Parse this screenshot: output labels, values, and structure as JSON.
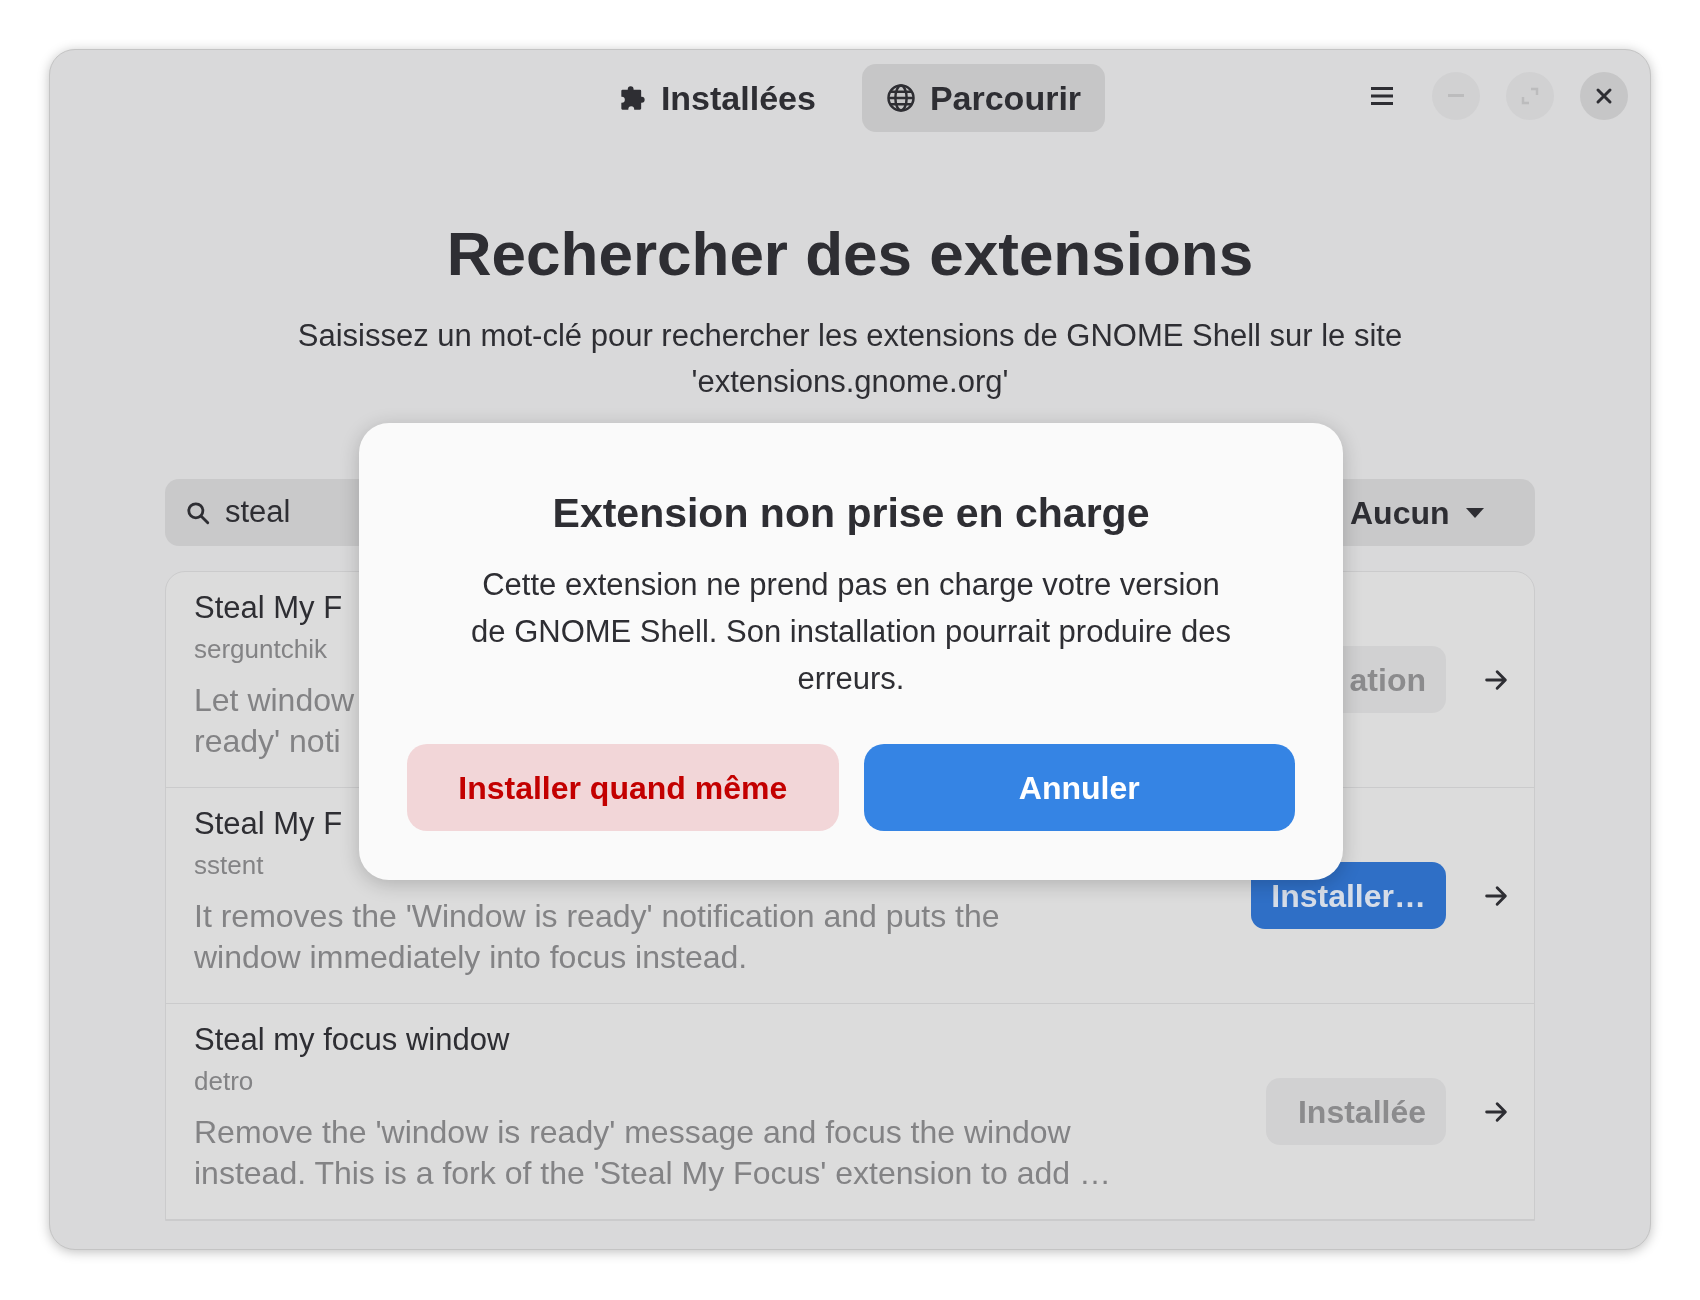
{
  "tabs": [
    {
      "label": "Installées",
      "selected": false
    },
    {
      "label": "Parcourir",
      "selected": true
    }
  ],
  "page": {
    "heading": "Rechercher des extensions",
    "subtitle": [
      "Saisissez un mot-clé pour rechercher les extensions de GNOME Shell sur le site",
      "'extensions.gnome.org'"
    ]
  },
  "search": {
    "value": "steal"
  },
  "filter": {
    "value": "Aucun"
  },
  "results": [
    {
      "title": "Steal My F",
      "author": "serguntchik",
      "description": [
        "Let window",
        "ready' noti"
      ],
      "action": {
        "label": "ation",
        "kind": "flat"
      }
    },
    {
      "title": "Steal My F",
      "author": "sstent",
      "description": [
        "It removes the 'Window is ready' notification and puts the",
        "window immediately into focus instead."
      ],
      "action": {
        "label": "Installer…",
        "kind": "suggested"
      }
    },
    {
      "title": "Steal my focus window",
      "author": "detro",
      "description": [
        "Remove the 'window is ready' message and focus the window",
        "instead. This is a fork of the 'Steal My Focus' extension to add …"
      ],
      "action": {
        "label": "Installée",
        "kind": "flat"
      }
    }
  ],
  "dialog": {
    "title": "Extension non prise en charge",
    "body": [
      "Cette extension ne prend pas en charge votre version",
      "de GNOME Shell. Son installation pourrait produire des",
      "erreurs."
    ],
    "buttons": [
      {
        "label": "Installer quand même",
        "kind": "destructive"
      },
      {
        "label": "Annuler",
        "kind": "suggested"
      }
    ]
  }
}
